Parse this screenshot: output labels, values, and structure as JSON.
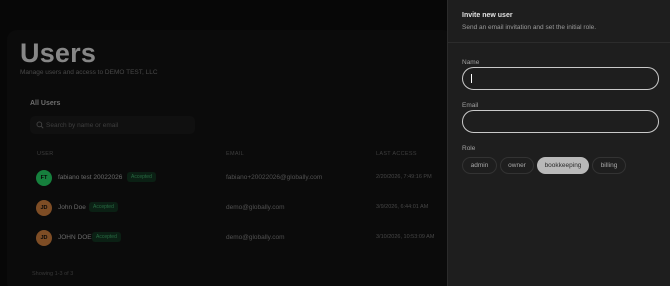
{
  "page": {
    "title": "Users",
    "subtitle": "Manage users and access to DEMO TEST, LLC",
    "section_title": "All Users",
    "search": {
      "placeholder": "Search by name or email"
    },
    "columns": {
      "user": "USER",
      "email": "EMAIL",
      "last_access": "LAST ACCESS"
    },
    "rows": [
      {
        "initials": "FT",
        "name": "fabiano test 20022026",
        "status": "Accepted",
        "email": "fabiano+20022026@globally.com",
        "last_access": "2/20/2026, 7:49:16 PM",
        "avatar_color": "#22c55e"
      },
      {
        "initials": "JD",
        "name": "John Doe",
        "status": "Accepted",
        "email": "demo@globally.com",
        "last_access": "3/9/2026, 6:44:01 AM",
        "avatar_color": "#c2773a"
      },
      {
        "initials": "JD",
        "name": "JOHN DOE",
        "status": "Accepted",
        "email": "demo@globally.com",
        "last_access": "3/10/2026, 10:53:09 AM",
        "avatar_color": "#c2773a"
      }
    ],
    "footer": "Showing 1-3 of 3"
  },
  "drawer": {
    "title": "Invite new user",
    "subtitle": "Send an email invitation and set the initial role.",
    "name_label": "Name",
    "name_value": "",
    "email_label": "Email",
    "email_value": "",
    "role_label": "Role",
    "roles": [
      {
        "label": "admin",
        "selected": false
      },
      {
        "label": "owner",
        "selected": false
      },
      {
        "label": "bookkeeping",
        "selected": true
      },
      {
        "label": "billing",
        "selected": false
      }
    ]
  },
  "colors": {
    "accent_badge": "#3ea366",
    "selected_role": "#b9b9b9"
  }
}
